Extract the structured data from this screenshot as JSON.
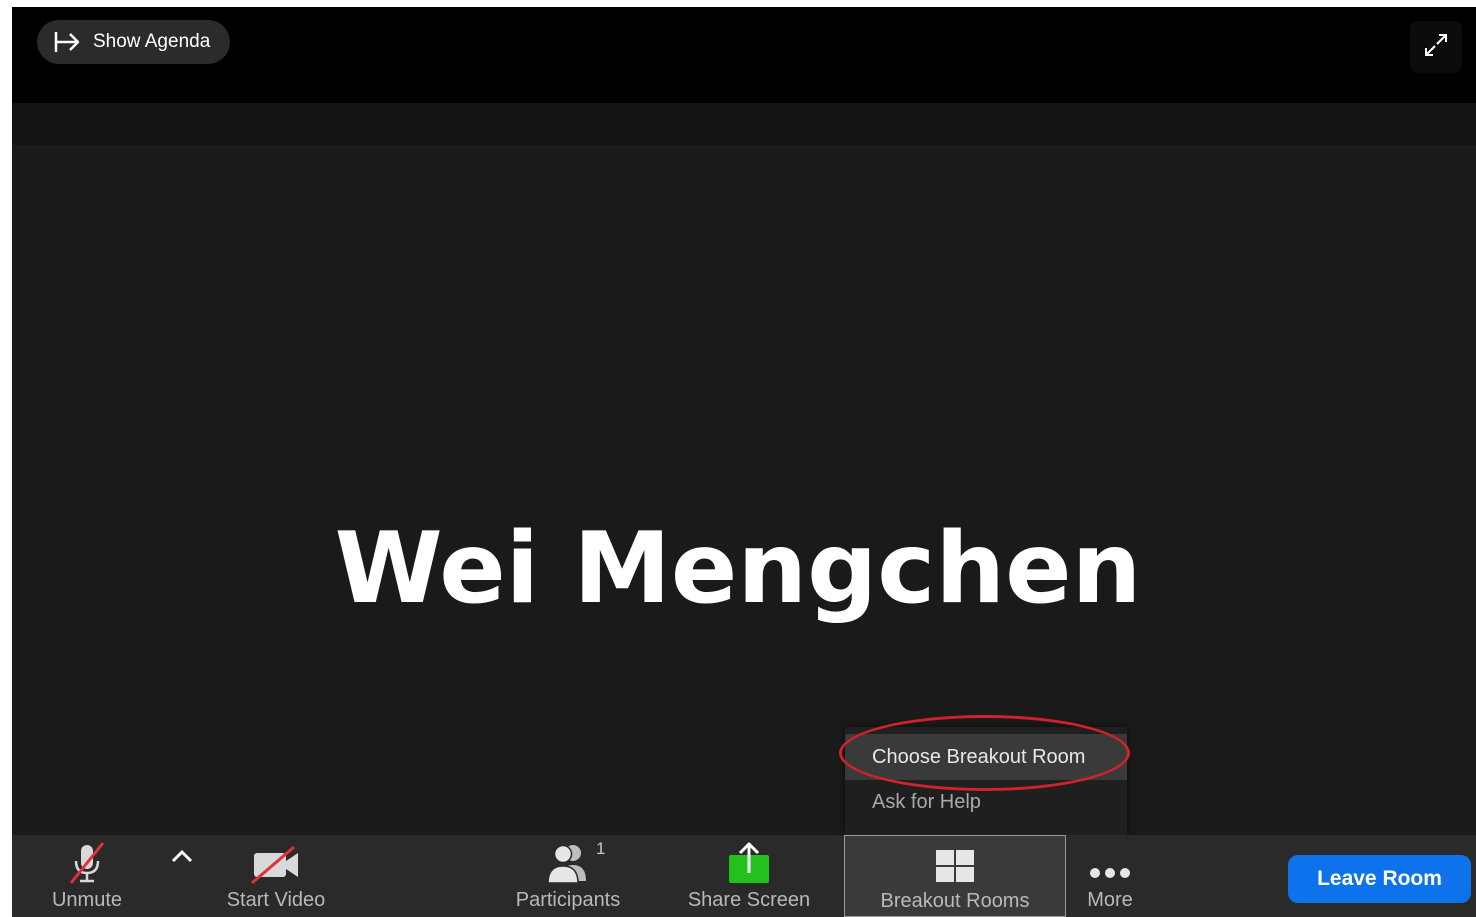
{
  "header": {
    "agenda_label": "Show Agenda"
  },
  "video": {
    "participant_name": "Wei Mengchen"
  },
  "breakout_menu": {
    "items": [
      {
        "label": "Choose Breakout Room",
        "highlighted": true
      },
      {
        "label": "Ask for Help",
        "highlighted": false
      }
    ]
  },
  "toolbar": {
    "unmute_label": "Unmute",
    "start_video_label": "Start Video",
    "participants_label": "Participants",
    "participants_count": "1",
    "share_screen_label": "Share Screen",
    "breakout_rooms_label": "Breakout Rooms",
    "more_label": "More",
    "leave_label": "Leave Room"
  },
  "colors": {
    "accent_blue": "#0e72ed",
    "share_green": "#23c11d",
    "annotation_red": "#d0222d",
    "muted_red": "#e0303a"
  },
  "icons": {
    "agenda": "arrow-right-bar-icon",
    "fullscreen": "expand-arrows-icon",
    "unmute": "microphone-muted-icon",
    "caret": "chevron-up-icon",
    "start_video": "video-camera-off-icon",
    "participants": "people-icon",
    "share_screen": "share-upload-icon",
    "breakout_rooms": "grid-four-icon",
    "more": "ellipsis-icon"
  }
}
